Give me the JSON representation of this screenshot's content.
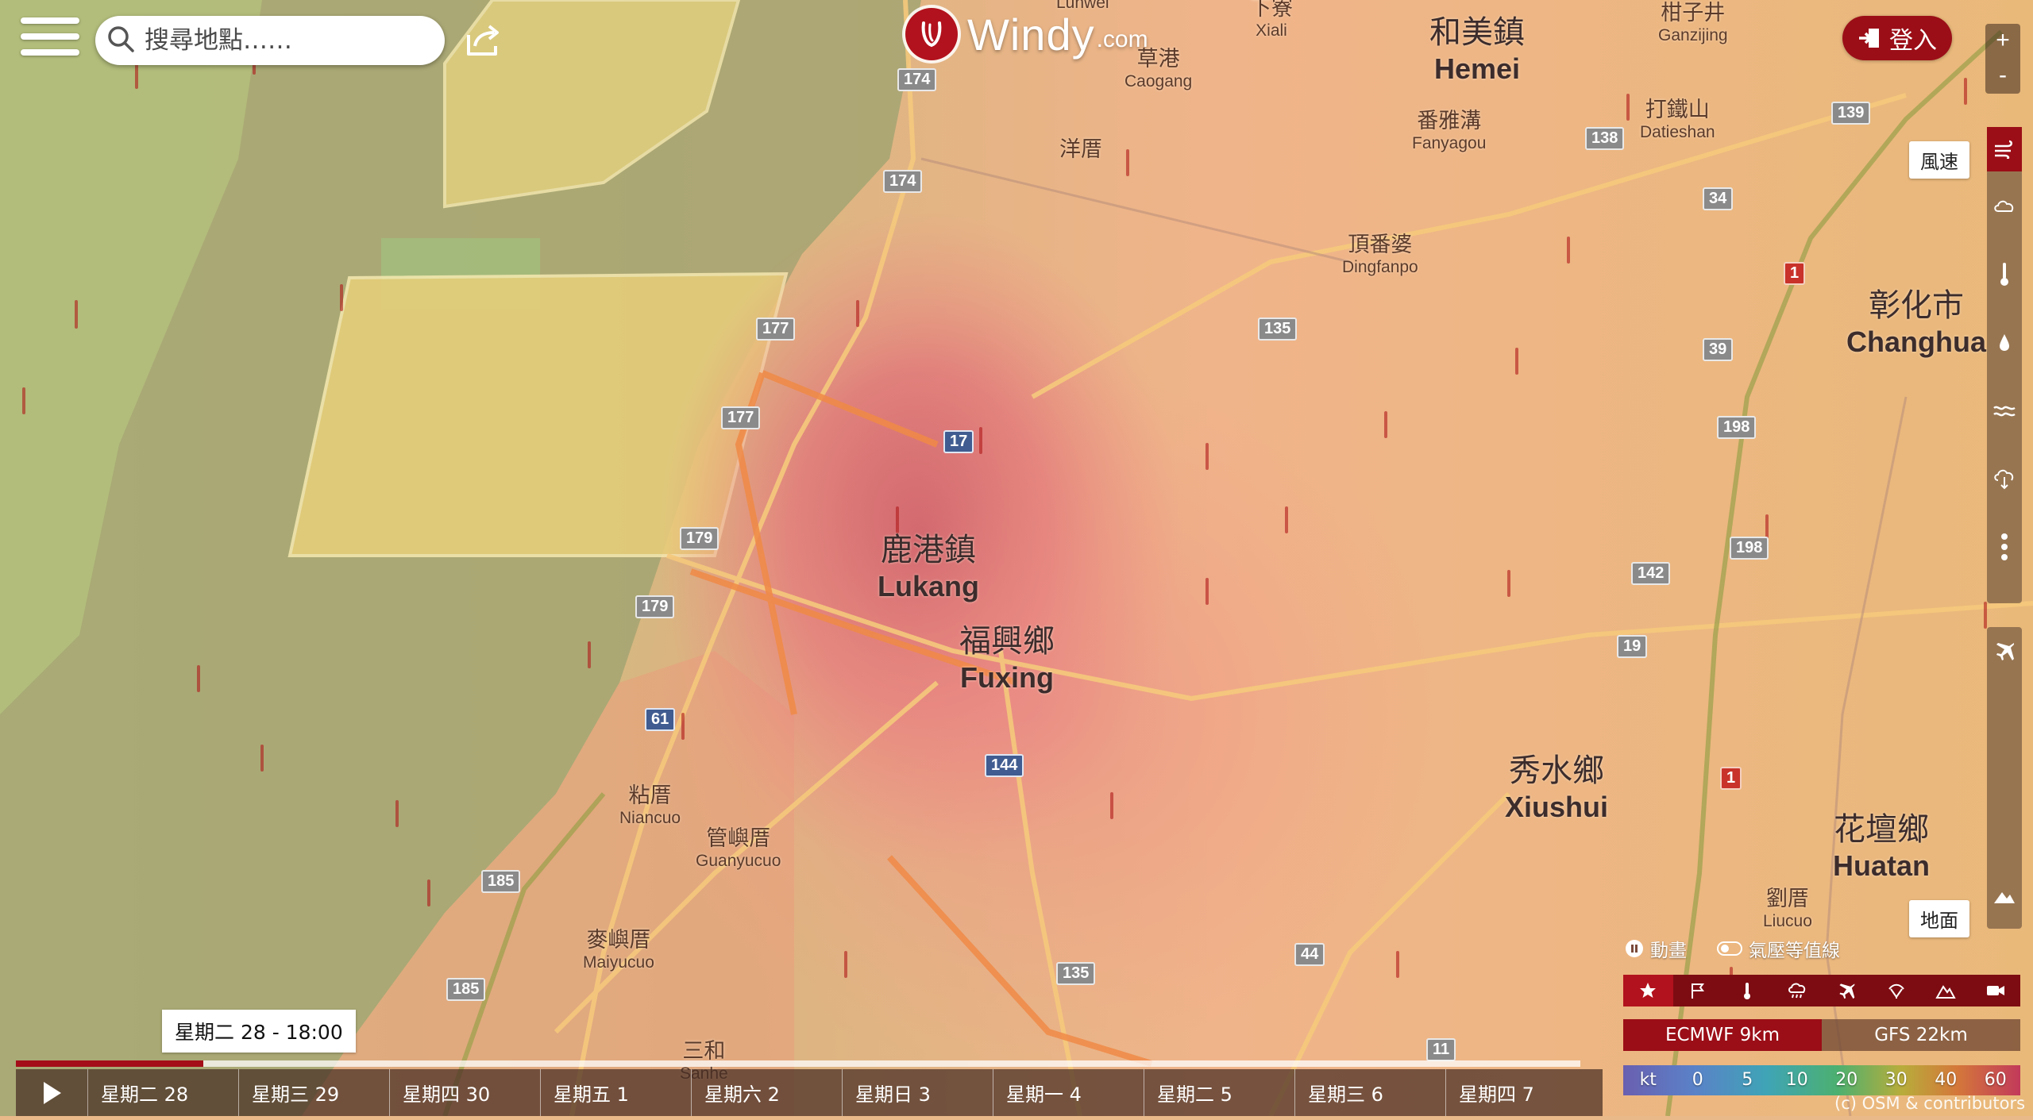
{
  "search": {
    "placeholder": "搜尋地點……"
  },
  "logo": {
    "word": "Windy",
    "suffix": ".com"
  },
  "login": {
    "label": "登入"
  },
  "zoom": {
    "in": "+",
    "out": "-"
  },
  "layers": {
    "wind_tooltip": "風速",
    "ground_tooltip": "地面",
    "items": [
      "wind-icon",
      "clouds-icon",
      "temperature-icon",
      "rain-icon",
      "waves-icon",
      "cloud-download-icon",
      "more-icon"
    ],
    "secondary": [
      "airplane-icon",
      "mountain-icon"
    ]
  },
  "controls": {
    "animation": "動畫",
    "isobars": "氣壓等值線"
  },
  "modes": [
    "star-icon",
    "flag-icon",
    "thermometer-icon",
    "cloud-rain-icon",
    "airplane-icon",
    "rocket-icon",
    "mountain-icon",
    "camera-icon"
  ],
  "models": {
    "active": "ECMWF 9km",
    "other": "GFS 22km"
  },
  "legend": {
    "unit": "kt",
    "values": [
      "0",
      "5",
      "10",
      "20",
      "30",
      "40",
      "60"
    ]
  },
  "credit": "(c) OSM & contributors",
  "timeline": {
    "current": "星期二 28 - 18:00",
    "progress": 0.12,
    "days": [
      "星期二 28",
      "星期三 29",
      "星期四 30",
      "星期五 1",
      "星期六 2",
      "星期日 3",
      "星期一 4",
      "星期二 5",
      "星期三 6",
      "星期四 7"
    ]
  },
  "map": {
    "places": [
      {
        "zh": "鹿港鎮",
        "en": "Lukang"
      },
      {
        "zh": "福興鄉",
        "en": "Fuxing"
      },
      {
        "zh": "和美鎮",
        "en": "Hemei"
      },
      {
        "zh": "彰化市",
        "en": "Changhua"
      },
      {
        "zh": "秀水鄉",
        "en": "Xiushui"
      },
      {
        "zh": "花壇鄉",
        "en": "Huatan"
      },
      {
        "zh": "頂番婆",
        "en": "Dingfanpo"
      },
      {
        "zh": "番雅溝",
        "en": "Fanyagou"
      },
      {
        "zh": "打鐵山",
        "en": "Datieshan"
      },
      {
        "zh": "粘厝",
        "en": "Niancuo"
      },
      {
        "zh": "管嶼厝",
        "en": "Guanyucuo"
      },
      {
        "zh": "麥嶼厝",
        "en": "Maiyucuo"
      },
      {
        "zh": "劉厝",
        "en": "Liucuo"
      },
      {
        "zh": "草港",
        "en": "Caogang"
      },
      {
        "zh": "柑子井",
        "en": "Ganzijing"
      },
      {
        "zh": "下寮",
        "en": "Xiali"
      },
      {
        "zh": "洋厝",
        "en": ""
      },
      {
        "zh": "三和",
        "en": "Sanhe"
      }
    ],
    "top_partial": "Lunwei",
    "routes": [
      "174",
      "174",
      "177",
      "177",
      "179",
      "179",
      "185",
      "185",
      "17",
      "135",
      "135",
      "61",
      "144",
      "138",
      "139",
      "34",
      "39",
      "198",
      "198",
      "142",
      "19",
      "44",
      "1",
      "1",
      "11"
    ]
  }
}
